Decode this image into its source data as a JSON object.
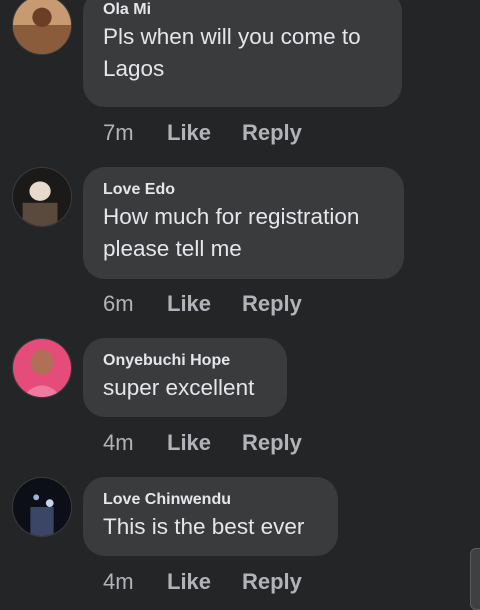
{
  "comments": [
    {
      "author": "Ola Mi",
      "text": "Pls when will you come to Lagos",
      "time": "7m",
      "like_label": "Like",
      "reply_label": "Reply"
    },
    {
      "author": "Love Edo",
      "text": "How much for registration please tell me",
      "time": "6m",
      "like_label": "Like",
      "reply_label": "Reply"
    },
    {
      "author": "Onyebuchi Hope",
      "text": "super excellent",
      "time": "4m",
      "like_label": "Like",
      "reply_label": "Reply"
    },
    {
      "author": "Love Chinwendu",
      "text": "This is the best ever",
      "time": "4m",
      "like_label": "Like",
      "reply_label": "Reply"
    }
  ],
  "colors": {
    "background": "#242526",
    "bubble": "#3a3b3c",
    "primary_text": "#e4e6eb",
    "secondary_text": "#b0b3b8"
  }
}
